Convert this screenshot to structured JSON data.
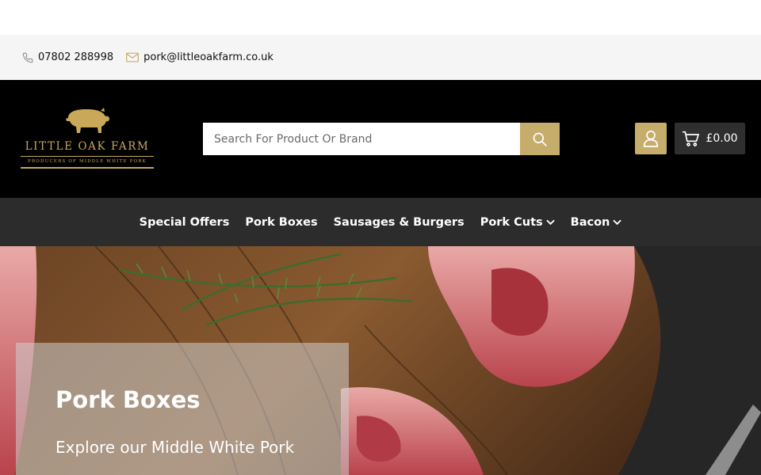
{
  "contact": {
    "phone": "07802 288998",
    "email": "pork@littleoakfarm.co.uk"
  },
  "logo": {
    "name": "LITTLE OAK FARM",
    "tagline": "PRODUCERS OF MIDDLE WHITE PORK"
  },
  "search": {
    "placeholder": "Search For Product Or Brand"
  },
  "cart": {
    "total": "£0.00"
  },
  "nav": {
    "items": [
      {
        "label": "Special Offers",
        "has_dropdown": false
      },
      {
        "label": "Pork Boxes",
        "has_dropdown": false
      },
      {
        "label": "Sausages & Burgers",
        "has_dropdown": false
      },
      {
        "label": "Pork Cuts",
        "has_dropdown": true
      },
      {
        "label": "Bacon",
        "has_dropdown": true
      }
    ]
  },
  "hero": {
    "title": "Pork Boxes",
    "subtitle": "Explore our Middle White Pork"
  },
  "colors": {
    "gold": "#c7ad6b",
    "header_bg": "#000000",
    "nav_bg": "#2c2c2c",
    "contact_bg": "#f5f5f5"
  }
}
